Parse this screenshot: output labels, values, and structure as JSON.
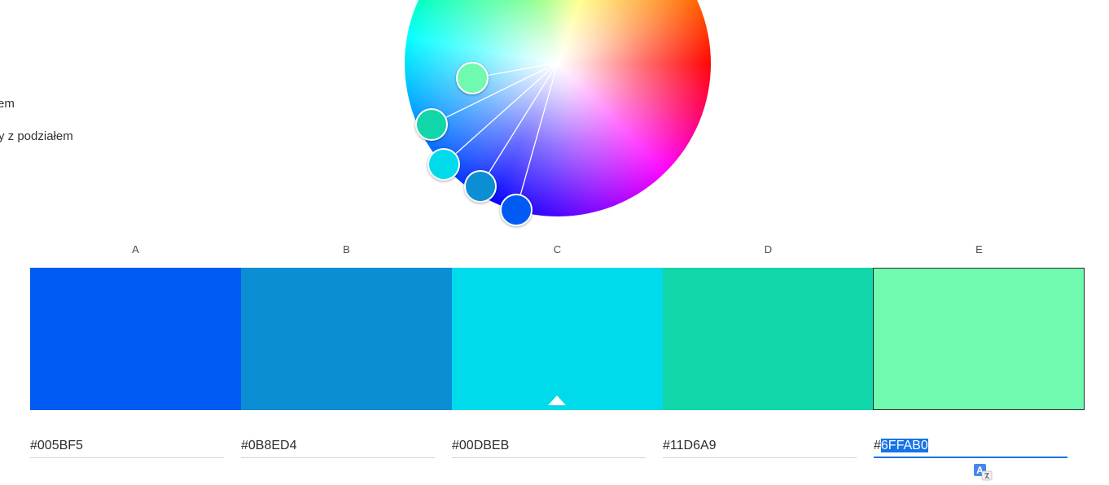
{
  "left_menu": {
    "items": [
      {
        "label": "em"
      },
      {
        "label": "y z podziałem"
      }
    ]
  },
  "swatches": [
    {
      "label": "A",
      "hex": "#005BF5",
      "color": "#005BF5"
    },
    {
      "label": "B",
      "hex": "#0B8ED4",
      "color": "#0B8ED4"
    },
    {
      "label": "C",
      "hex": "#00DBEB",
      "color": "#00DBEB"
    },
    {
      "label": "D",
      "hex": "#11D6A9",
      "color": "#11D6A9"
    },
    {
      "label": "E",
      "hex": "#6FFAB0",
      "color": "#6FFAB0"
    }
  ],
  "active_field": {
    "prefix": "#",
    "selected_text": "6FFAB0"
  },
  "colors": {
    "accent": "#1473E6",
    "selected_swatch_border": "#2A2A2A"
  },
  "icons": {
    "translate": "translate-icon",
    "caret": "caret-up-icon"
  }
}
